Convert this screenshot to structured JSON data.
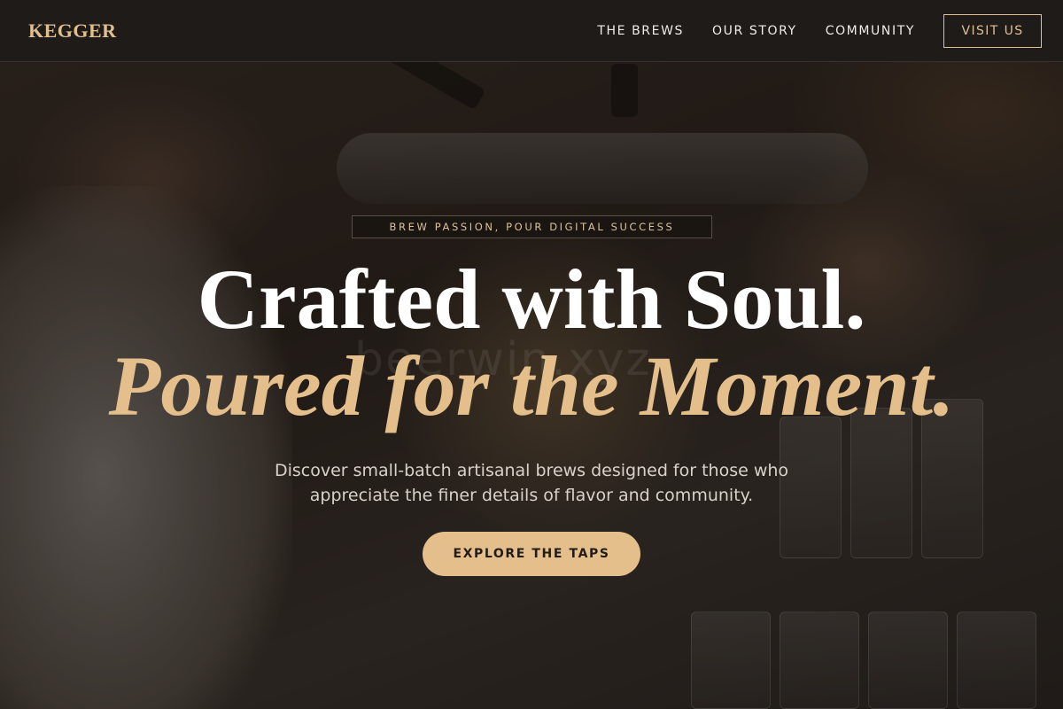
{
  "nav": {
    "logo": "KEGGER",
    "links": [
      "THE BREWS",
      "OUR STORY",
      "COMMUNITY"
    ],
    "visit_label": "VISIT US"
  },
  "hero": {
    "tagline": "BREW PASSION, POUR DIGITAL SUCCESS",
    "headline_line1": "Crafted with Soul.",
    "headline_line2": "Poured for the Moment.",
    "watermark": "beerwin.xyz",
    "description": "Discover small-batch artisanal brews designed for those who appreciate the finer details of flavor and community.",
    "cta_label": "EXPLORE THE TAPS"
  },
  "colors": {
    "accent": "#e4bf8b",
    "navbar_bg": "#1f1b19",
    "headline": "#ffffff",
    "cta_text": "#231c16"
  }
}
